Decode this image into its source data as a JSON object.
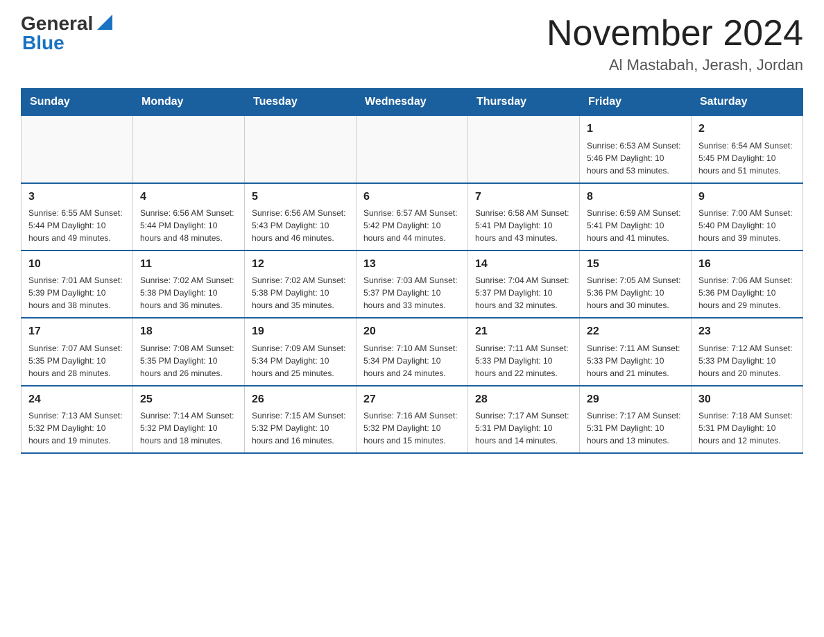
{
  "logo": {
    "general": "General",
    "blue": "Blue"
  },
  "calendar": {
    "title": "November 2024",
    "subtitle": "Al Mastabah, Jerash, Jordan",
    "days_of_week": [
      "Sunday",
      "Monday",
      "Tuesday",
      "Wednesday",
      "Thursday",
      "Friday",
      "Saturday"
    ],
    "weeks": [
      [
        {
          "day": "",
          "info": ""
        },
        {
          "day": "",
          "info": ""
        },
        {
          "day": "",
          "info": ""
        },
        {
          "day": "",
          "info": ""
        },
        {
          "day": "",
          "info": ""
        },
        {
          "day": "1",
          "info": "Sunrise: 6:53 AM\nSunset: 5:46 PM\nDaylight: 10 hours and 53 minutes."
        },
        {
          "day": "2",
          "info": "Sunrise: 6:54 AM\nSunset: 5:45 PM\nDaylight: 10 hours and 51 minutes."
        }
      ],
      [
        {
          "day": "3",
          "info": "Sunrise: 6:55 AM\nSunset: 5:44 PM\nDaylight: 10 hours and 49 minutes."
        },
        {
          "day": "4",
          "info": "Sunrise: 6:56 AM\nSunset: 5:44 PM\nDaylight: 10 hours and 48 minutes."
        },
        {
          "day": "5",
          "info": "Sunrise: 6:56 AM\nSunset: 5:43 PM\nDaylight: 10 hours and 46 minutes."
        },
        {
          "day": "6",
          "info": "Sunrise: 6:57 AM\nSunset: 5:42 PM\nDaylight: 10 hours and 44 minutes."
        },
        {
          "day": "7",
          "info": "Sunrise: 6:58 AM\nSunset: 5:41 PM\nDaylight: 10 hours and 43 minutes."
        },
        {
          "day": "8",
          "info": "Sunrise: 6:59 AM\nSunset: 5:41 PM\nDaylight: 10 hours and 41 minutes."
        },
        {
          "day": "9",
          "info": "Sunrise: 7:00 AM\nSunset: 5:40 PM\nDaylight: 10 hours and 39 minutes."
        }
      ],
      [
        {
          "day": "10",
          "info": "Sunrise: 7:01 AM\nSunset: 5:39 PM\nDaylight: 10 hours and 38 minutes."
        },
        {
          "day": "11",
          "info": "Sunrise: 7:02 AM\nSunset: 5:38 PM\nDaylight: 10 hours and 36 minutes."
        },
        {
          "day": "12",
          "info": "Sunrise: 7:02 AM\nSunset: 5:38 PM\nDaylight: 10 hours and 35 minutes."
        },
        {
          "day": "13",
          "info": "Sunrise: 7:03 AM\nSunset: 5:37 PM\nDaylight: 10 hours and 33 minutes."
        },
        {
          "day": "14",
          "info": "Sunrise: 7:04 AM\nSunset: 5:37 PM\nDaylight: 10 hours and 32 minutes."
        },
        {
          "day": "15",
          "info": "Sunrise: 7:05 AM\nSunset: 5:36 PM\nDaylight: 10 hours and 30 minutes."
        },
        {
          "day": "16",
          "info": "Sunrise: 7:06 AM\nSunset: 5:36 PM\nDaylight: 10 hours and 29 minutes."
        }
      ],
      [
        {
          "day": "17",
          "info": "Sunrise: 7:07 AM\nSunset: 5:35 PM\nDaylight: 10 hours and 28 minutes."
        },
        {
          "day": "18",
          "info": "Sunrise: 7:08 AM\nSunset: 5:35 PM\nDaylight: 10 hours and 26 minutes."
        },
        {
          "day": "19",
          "info": "Sunrise: 7:09 AM\nSunset: 5:34 PM\nDaylight: 10 hours and 25 minutes."
        },
        {
          "day": "20",
          "info": "Sunrise: 7:10 AM\nSunset: 5:34 PM\nDaylight: 10 hours and 24 minutes."
        },
        {
          "day": "21",
          "info": "Sunrise: 7:11 AM\nSunset: 5:33 PM\nDaylight: 10 hours and 22 minutes."
        },
        {
          "day": "22",
          "info": "Sunrise: 7:11 AM\nSunset: 5:33 PM\nDaylight: 10 hours and 21 minutes."
        },
        {
          "day": "23",
          "info": "Sunrise: 7:12 AM\nSunset: 5:33 PM\nDaylight: 10 hours and 20 minutes."
        }
      ],
      [
        {
          "day": "24",
          "info": "Sunrise: 7:13 AM\nSunset: 5:32 PM\nDaylight: 10 hours and 19 minutes."
        },
        {
          "day": "25",
          "info": "Sunrise: 7:14 AM\nSunset: 5:32 PM\nDaylight: 10 hours and 18 minutes."
        },
        {
          "day": "26",
          "info": "Sunrise: 7:15 AM\nSunset: 5:32 PM\nDaylight: 10 hours and 16 minutes."
        },
        {
          "day": "27",
          "info": "Sunrise: 7:16 AM\nSunset: 5:32 PM\nDaylight: 10 hours and 15 minutes."
        },
        {
          "day": "28",
          "info": "Sunrise: 7:17 AM\nSunset: 5:31 PM\nDaylight: 10 hours and 14 minutes."
        },
        {
          "day": "29",
          "info": "Sunrise: 7:17 AM\nSunset: 5:31 PM\nDaylight: 10 hours and 13 minutes."
        },
        {
          "day": "30",
          "info": "Sunrise: 7:18 AM\nSunset: 5:31 PM\nDaylight: 10 hours and 12 minutes."
        }
      ]
    ]
  }
}
